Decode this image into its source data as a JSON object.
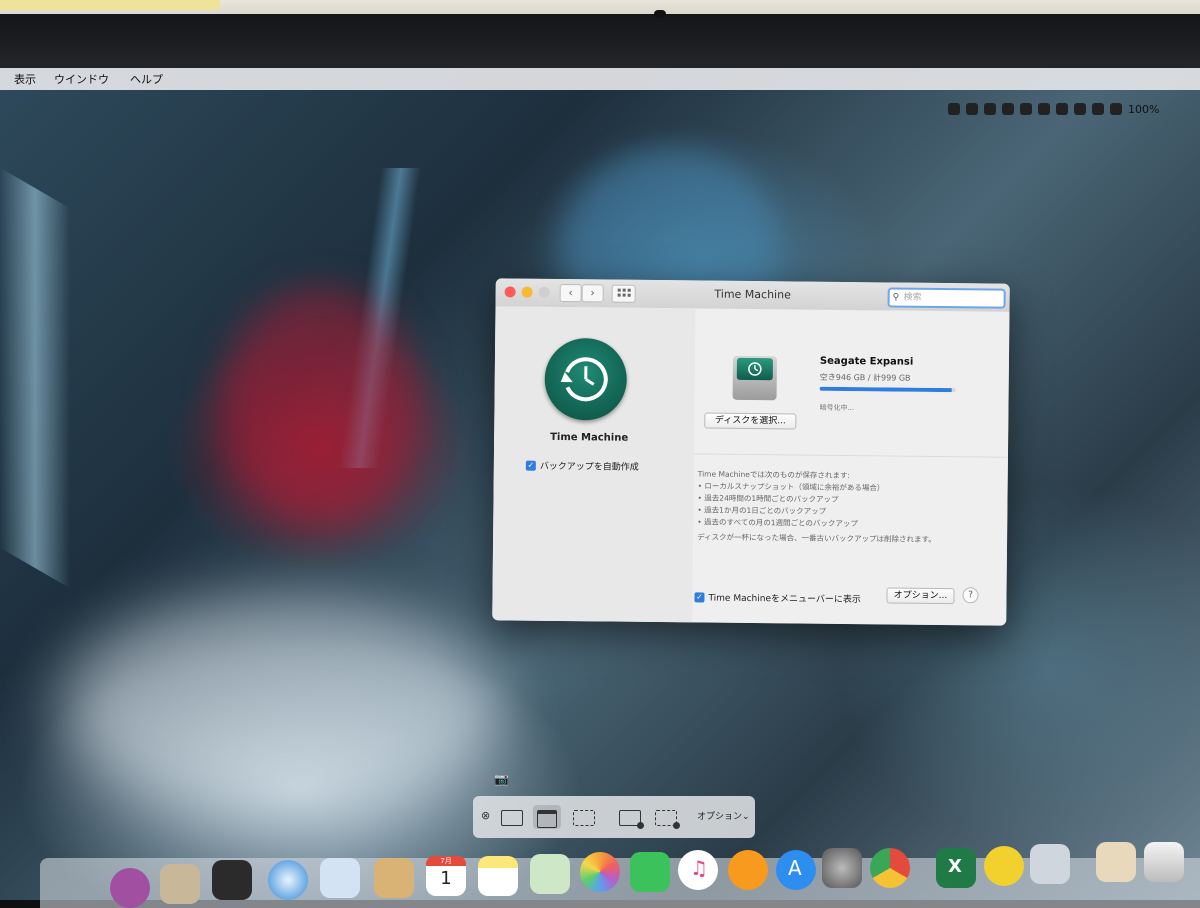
{
  "menubar": {
    "items": [
      "表示",
      "ウインドウ",
      "ヘルプ"
    ],
    "battery": "100%"
  },
  "window": {
    "title": "Time Machine",
    "search_placeholder": "検索",
    "app_label": "Time Machine",
    "auto_backup_label": "バックアップを自動作成",
    "auto_backup_checked": true,
    "select_disk_button": "ディスクを選択...",
    "disk": {
      "name": "Seagate Expansi",
      "space": "空き946 GB / 計999 GB",
      "status": "暗号化中...",
      "progress": 0.97
    },
    "info": {
      "heading": "Time Machineでは次のものが保存されます:",
      "items": [
        "• ローカルスナップショット（領域に余裕がある場合）",
        "• 過去24時間の1時間ごとのバックアップ",
        "• 過去1か月の1日ごとのバックアップ",
        "• 過去のすべての月の1週間ごとのバックアップ"
      ],
      "note": "ディスクが一杯になった場合、一番古いバックアップは削除されます。"
    },
    "menubar_checkbox_label": "Time Machineをメニューバーに表示",
    "menubar_checkbox_checked": true,
    "options_button": "オプション...",
    "help_button": "?"
  },
  "screenshot_toolbar": {
    "options_label": "オプション⌄"
  },
  "dock": {
    "calendar_day": "1",
    "calendar_month": "7月",
    "excel_letter": "X"
  }
}
